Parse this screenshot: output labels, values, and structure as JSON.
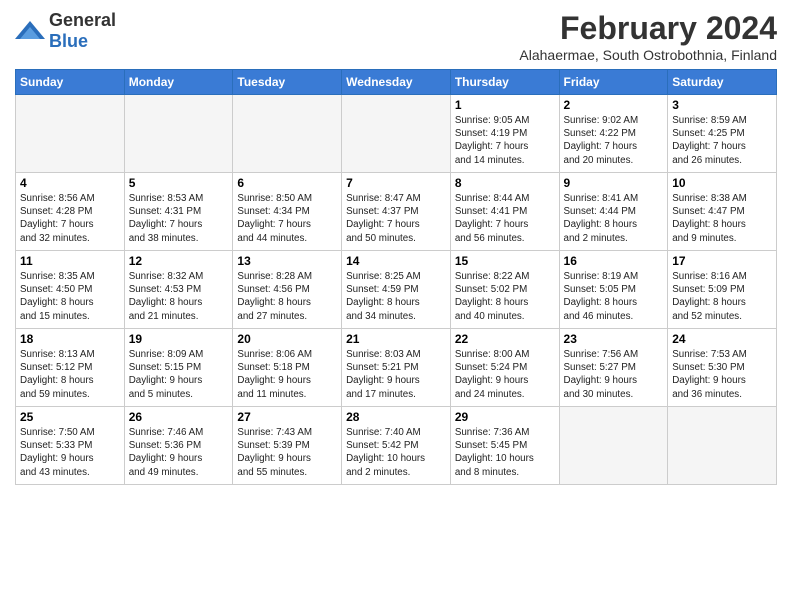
{
  "header": {
    "logo_general": "General",
    "logo_blue": "Blue",
    "month_year": "February 2024",
    "location": "Alahaermae, South Ostrobothnia, Finland"
  },
  "weekdays": [
    "Sunday",
    "Monday",
    "Tuesday",
    "Wednesday",
    "Thursday",
    "Friday",
    "Saturday"
  ],
  "weeks": [
    [
      {
        "day": "",
        "empty": true
      },
      {
        "day": "",
        "empty": true
      },
      {
        "day": "",
        "empty": true
      },
      {
        "day": "",
        "empty": true
      },
      {
        "day": "1",
        "info": "Sunrise: 9:05 AM\nSunset: 4:19 PM\nDaylight: 7 hours\nand 14 minutes."
      },
      {
        "day": "2",
        "info": "Sunrise: 9:02 AM\nSunset: 4:22 PM\nDaylight: 7 hours\nand 20 minutes."
      },
      {
        "day": "3",
        "info": "Sunrise: 8:59 AM\nSunset: 4:25 PM\nDaylight: 7 hours\nand 26 minutes."
      }
    ],
    [
      {
        "day": "4",
        "info": "Sunrise: 8:56 AM\nSunset: 4:28 PM\nDaylight: 7 hours\nand 32 minutes."
      },
      {
        "day": "5",
        "info": "Sunrise: 8:53 AM\nSunset: 4:31 PM\nDaylight: 7 hours\nand 38 minutes."
      },
      {
        "day": "6",
        "info": "Sunrise: 8:50 AM\nSunset: 4:34 PM\nDaylight: 7 hours\nand 44 minutes."
      },
      {
        "day": "7",
        "info": "Sunrise: 8:47 AM\nSunset: 4:37 PM\nDaylight: 7 hours\nand 50 minutes."
      },
      {
        "day": "8",
        "info": "Sunrise: 8:44 AM\nSunset: 4:41 PM\nDaylight: 7 hours\nand 56 minutes."
      },
      {
        "day": "9",
        "info": "Sunrise: 8:41 AM\nSunset: 4:44 PM\nDaylight: 8 hours\nand 2 minutes."
      },
      {
        "day": "10",
        "info": "Sunrise: 8:38 AM\nSunset: 4:47 PM\nDaylight: 8 hours\nand 9 minutes."
      }
    ],
    [
      {
        "day": "11",
        "info": "Sunrise: 8:35 AM\nSunset: 4:50 PM\nDaylight: 8 hours\nand 15 minutes."
      },
      {
        "day": "12",
        "info": "Sunrise: 8:32 AM\nSunset: 4:53 PM\nDaylight: 8 hours\nand 21 minutes."
      },
      {
        "day": "13",
        "info": "Sunrise: 8:28 AM\nSunset: 4:56 PM\nDaylight: 8 hours\nand 27 minutes."
      },
      {
        "day": "14",
        "info": "Sunrise: 8:25 AM\nSunset: 4:59 PM\nDaylight: 8 hours\nand 34 minutes."
      },
      {
        "day": "15",
        "info": "Sunrise: 8:22 AM\nSunset: 5:02 PM\nDaylight: 8 hours\nand 40 minutes."
      },
      {
        "day": "16",
        "info": "Sunrise: 8:19 AM\nSunset: 5:05 PM\nDaylight: 8 hours\nand 46 minutes."
      },
      {
        "day": "17",
        "info": "Sunrise: 8:16 AM\nSunset: 5:09 PM\nDaylight: 8 hours\nand 52 minutes."
      }
    ],
    [
      {
        "day": "18",
        "info": "Sunrise: 8:13 AM\nSunset: 5:12 PM\nDaylight: 8 hours\nand 59 minutes."
      },
      {
        "day": "19",
        "info": "Sunrise: 8:09 AM\nSunset: 5:15 PM\nDaylight: 9 hours\nand 5 minutes."
      },
      {
        "day": "20",
        "info": "Sunrise: 8:06 AM\nSunset: 5:18 PM\nDaylight: 9 hours\nand 11 minutes."
      },
      {
        "day": "21",
        "info": "Sunrise: 8:03 AM\nSunset: 5:21 PM\nDaylight: 9 hours\nand 17 minutes."
      },
      {
        "day": "22",
        "info": "Sunrise: 8:00 AM\nSunset: 5:24 PM\nDaylight: 9 hours\nand 24 minutes."
      },
      {
        "day": "23",
        "info": "Sunrise: 7:56 AM\nSunset: 5:27 PM\nDaylight: 9 hours\nand 30 minutes."
      },
      {
        "day": "24",
        "info": "Sunrise: 7:53 AM\nSunset: 5:30 PM\nDaylight: 9 hours\nand 36 minutes."
      }
    ],
    [
      {
        "day": "25",
        "info": "Sunrise: 7:50 AM\nSunset: 5:33 PM\nDaylight: 9 hours\nand 43 minutes."
      },
      {
        "day": "26",
        "info": "Sunrise: 7:46 AM\nSunset: 5:36 PM\nDaylight: 9 hours\nand 49 minutes."
      },
      {
        "day": "27",
        "info": "Sunrise: 7:43 AM\nSunset: 5:39 PM\nDaylight: 9 hours\nand 55 minutes."
      },
      {
        "day": "28",
        "info": "Sunrise: 7:40 AM\nSunset: 5:42 PM\nDaylight: 10 hours\nand 2 minutes."
      },
      {
        "day": "29",
        "info": "Sunrise: 7:36 AM\nSunset: 5:45 PM\nDaylight: 10 hours\nand 8 minutes."
      },
      {
        "day": "",
        "empty": true
      },
      {
        "day": "",
        "empty": true
      }
    ]
  ]
}
